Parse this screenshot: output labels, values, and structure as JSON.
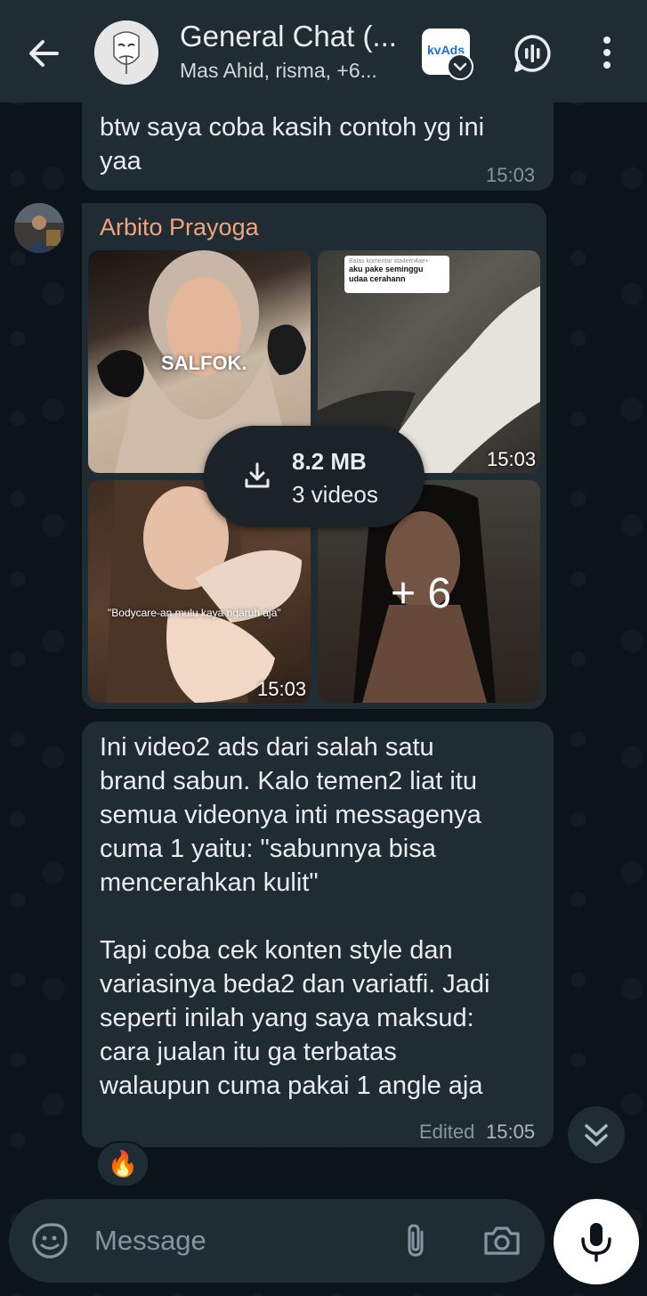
{
  "header": {
    "title": "General Chat (...",
    "subtitle": "Mas Ahid, risma, +6...",
    "app_icon_label": "kvAds"
  },
  "messages": {
    "first": {
      "text": "btw saya coba kasih contoh yg ini\nyaa",
      "time": "15:03"
    },
    "media": {
      "sender": "Arbito Prayoga",
      "tile1_caption": "SALFOK.",
      "tile2_caption_small": "Balas komentar sta4erri4ae+",
      "tile2_caption": "aku pake seminggu\nudaa cerahann",
      "tile2_time": "15:03",
      "tile3_caption": "\"Bodycare-an mulu kaya ngaruh aja\"",
      "tile3_time": "15:03",
      "more_count": "+ 6",
      "download_size": "8.2 MB",
      "download_count": "3 videos"
    },
    "long": {
      "text": "Ini video2 ads dari salah satu\nbrand sabun. Kalo temen2 liat itu\nsemua videonya inti messagenya\ncuma 1 yaitu: \"sabunnya bisa\nmencerahkan kulit\"\n\nTapi coba cek konten style dan\nvariasinya beda2 dan variatfi. Jadi\nseperti inilah yang saya maksud:\ncara jualan itu ga terbatas\nwalaupun cuma pakai 1 angle aja",
      "edited": "Edited",
      "time": "15:05",
      "reaction": "🔥"
    }
  },
  "input": {
    "placeholder": "Message"
  },
  "colors": {
    "accent_name": "#f3a47c",
    "bubble": "#1f2c34",
    "background": "#0b141a"
  }
}
